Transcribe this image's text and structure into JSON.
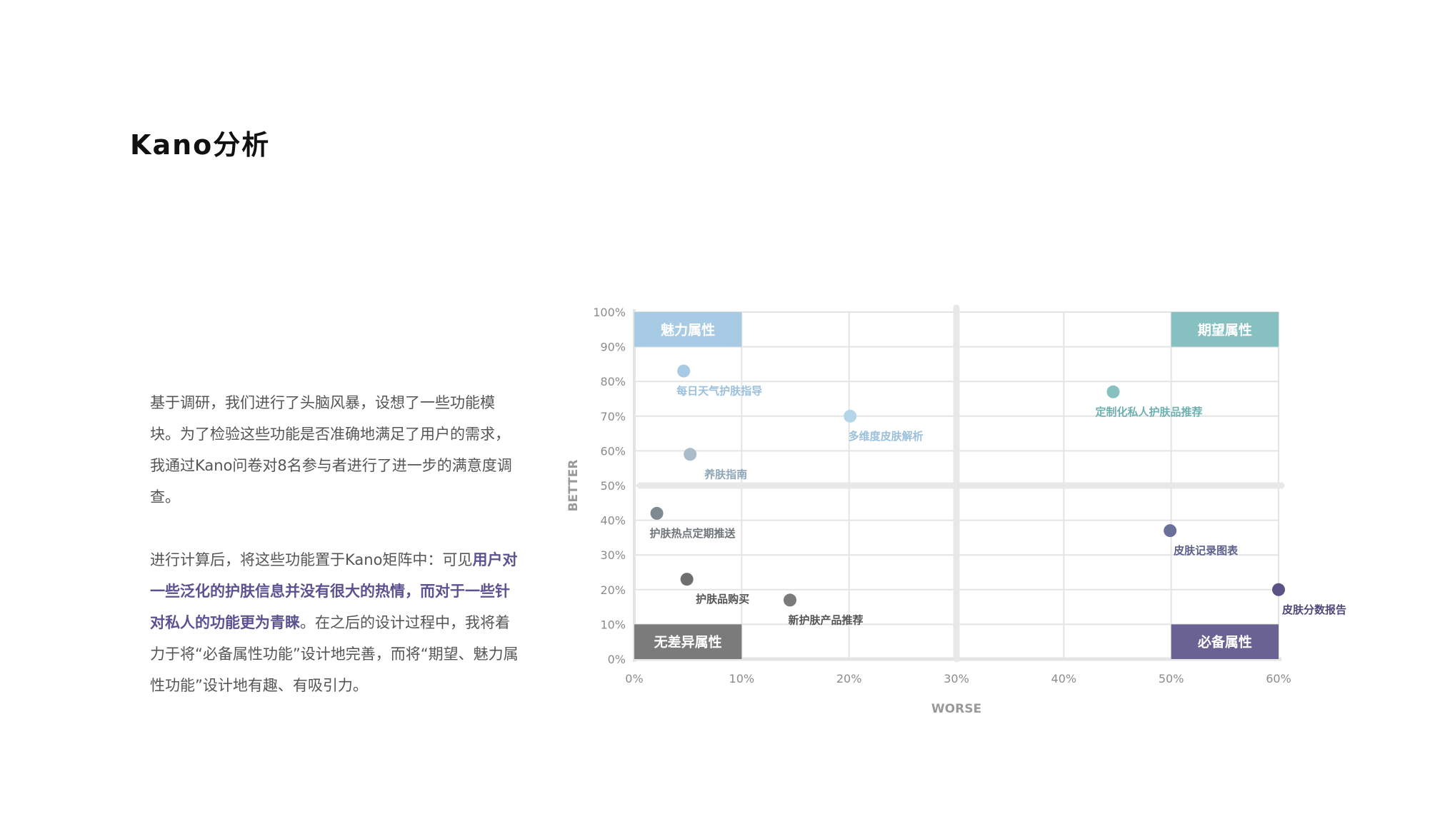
{
  "title": "Kano分析",
  "intro": {
    "p1": "基于调研，我们进行了头脑风暴，设想了一些功能模块。为了检验这些功能是否准确地满足了用户的需求，我通过Kano问卷对8名参与者进行了进一步的满意度调查。",
    "p2_a": "进行计算后，将这些功能置于Kano矩阵中：可见",
    "p2_highlight": "用户对一些泛化的护肤信息并没有很大的热情，而对于一些针对私人的功能更为青睐",
    "p2_b": "。在之后的设计过程中，我将着力于将“必备属性功能”设计地完善，而将“期望、魅力属性功能”设计地有趣、有吸引力。"
  },
  "colors": {
    "highlight": "#5b5391",
    "attractive": "#a7cbe4",
    "performance": "#86c0c0",
    "indifferent": "#7b7b7b",
    "must_be": "#6b6294",
    "grid": "#e4e4e4",
    "divider": "#e8e8e8",
    "tick": "#8c8c8c"
  },
  "chart_data": {
    "type": "scatter",
    "xlabel": "WORSE",
    "ylabel": "BETTER",
    "xlim": [
      0,
      60
    ],
    "ylim": [
      0,
      100
    ],
    "x_ticks": [
      "0%",
      "10%",
      "20%",
      "30%",
      "40%",
      "50%",
      "60%"
    ],
    "y_ticks": [
      "0%",
      "10%",
      "20%",
      "30%",
      "40%",
      "50%",
      "60%",
      "70%",
      "80%",
      "90%",
      "100%"
    ],
    "x_divider": 30,
    "y_divider": 50,
    "quadrants": [
      {
        "label": "魅力属性",
        "position": "top-left",
        "color": "#a7cbe4"
      },
      {
        "label": "期望属性",
        "position": "top-right",
        "color": "#86c0c0"
      },
      {
        "label": "无差异属性",
        "position": "bottom-left",
        "color": "#7b7b7b"
      },
      {
        "label": "必备属性",
        "position": "bottom-right",
        "color": "#6b6294"
      }
    ],
    "points": [
      {
        "label": "每日天气护肤指导",
        "x": 4.6,
        "y": 83,
        "color": "#a7cbe4",
        "label_color": "#9ac0dc"
      },
      {
        "label": "多维度皮肤解析",
        "x": 20.1,
        "y": 70,
        "color": "#b4d6e8",
        "label_color": "#9ac0dc"
      },
      {
        "label": "养肤指南",
        "x": 5.2,
        "y": 59,
        "color": "#a9bcc8",
        "label_color": "#8fa6b6"
      },
      {
        "label": "定制化私人护肤品推荐",
        "x": 44.6,
        "y": 77,
        "color": "#86c0c0",
        "label_color": "#6fb0b0"
      },
      {
        "label": "护肤热点定期推送",
        "x": 2.1,
        "y": 42,
        "color": "#7f8a90",
        "label_color": "#6f777c"
      },
      {
        "label": "护肤品购买",
        "x": 4.9,
        "y": 23,
        "color": "#6e6e6e",
        "label_color": "#555555"
      },
      {
        "label": "新护肤产品推荐",
        "x": 14.5,
        "y": 17,
        "color": "#7b7b7b",
        "label_color": "#555555"
      },
      {
        "label": "皮肤记录图表",
        "x": 49.9,
        "y": 37,
        "color": "#6b6f9b",
        "label_color": "#5b5f8b"
      },
      {
        "label": "皮肤分数报告",
        "x": 60,
        "y": 20,
        "color": "#5b5385",
        "label_color": "#4f4978"
      }
    ]
  }
}
